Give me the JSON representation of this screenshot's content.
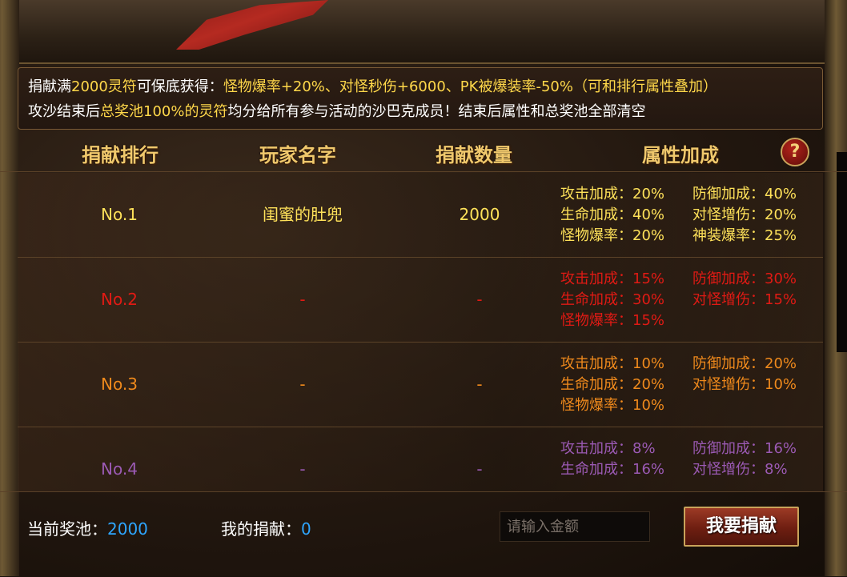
{
  "notice": {
    "line1_a": "捐献满",
    "line1_b": "2000灵符",
    "line1_c": "可保底获得：",
    "line1_d": "怪物爆率+20%、对怪秒伤+6000、PK被爆装率-50%（可和排行属性叠加）",
    "line2_a": "攻沙结束后",
    "line2_b": "总奖池100%的灵符",
    "line2_c": "均分给所有参与活动的沙巴克成员！结束后属性和总奖池全部清空"
  },
  "header": {
    "rank": "捐献排行",
    "player": "玩家名字",
    "amount": "捐献数量",
    "attrs": "属性加成",
    "help": "?"
  },
  "rows": [
    {
      "rank": "No.1",
      "player": "闺蜜的肚兜",
      "amount": "2000",
      "color": "#ffe25a",
      "attrs": [
        "攻击加成：20%",
        "防御加成：40%",
        "生命加成：40%",
        "对怪增伤：20%",
        "怪物爆率：20%",
        "神装爆率：25%"
      ]
    },
    {
      "rank": "No.2",
      "player": "-",
      "amount": "-",
      "color": "#e01a14",
      "attrs": [
        "攻击加成：15%",
        "防御加成：30%",
        "生命加成：30%",
        "对怪增伤：15%",
        "怪物爆率：15%",
        ""
      ]
    },
    {
      "rank": "No.3",
      "player": "-",
      "amount": "-",
      "color": "#f08a1c",
      "attrs": [
        "攻击加成：10%",
        "防御加成：20%",
        "生命加成：20%",
        "对怪增伤：10%",
        "怪物爆率：10%",
        ""
      ]
    },
    {
      "rank": "No.4",
      "player": "-",
      "amount": "-",
      "color": "#9b5ab4",
      "attrs": [
        "攻击加成：8%",
        "防御加成：16%",
        "生命加成：16%",
        "对怪增伤：8%",
        "",
        ""
      ]
    }
  ],
  "footer": {
    "pool_label": "当前奖池：",
    "pool_value": "2000",
    "mine_label": "我的捐献：",
    "mine_value": "0",
    "input_placeholder": "请输入金额",
    "donate_button": "我要捐献"
  }
}
